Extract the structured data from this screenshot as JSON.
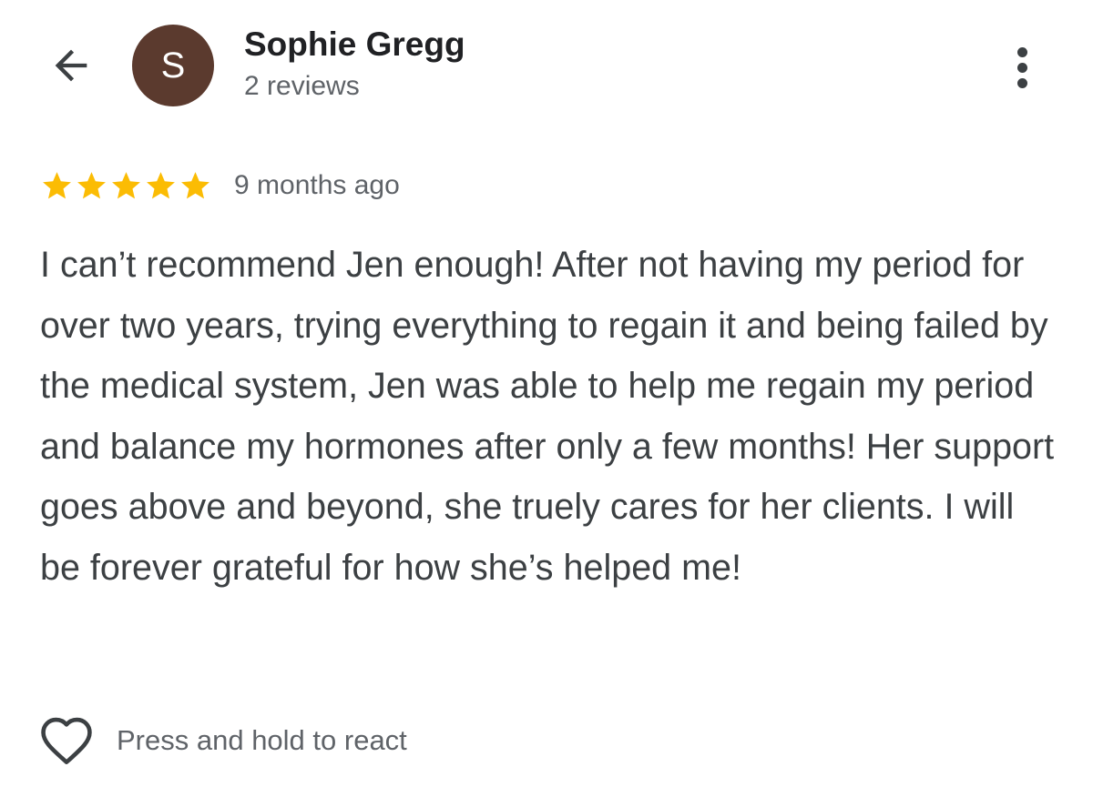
{
  "header": {
    "back_icon": "arrow-left-icon",
    "avatar_letter": "S",
    "avatar_color": "#5b3a2e",
    "reviewer_name": "Sophie Gregg",
    "review_count": "2 reviews",
    "more_icon": "more-vertical-icon"
  },
  "review": {
    "rating": 5,
    "rating_max": 5,
    "star_color": "#fbbc04",
    "star_icon": "star-icon",
    "time_ago": "9 months ago",
    "text": "I can’t recommend Jen enough! After not having my period for over two years, trying everything to regain it and being failed by the medical system, Jen was able to help me regain my period and balance my hormones after only a few months! Her support goes above and beyond, she truely cares for her clients. I will be forever grateful for how she’s helped me!"
  },
  "reaction": {
    "icon": "heart-outline-icon",
    "label": "Press and hold to react"
  }
}
